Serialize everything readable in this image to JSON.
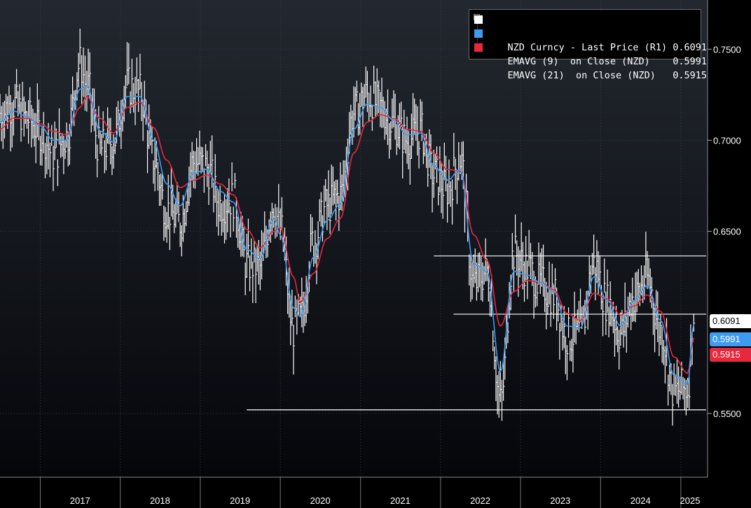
{
  "chart_data": {
    "type": "line",
    "x_range": [
      "2016-07",
      "2025-04"
    ],
    "ylim": [
      0.515,
      0.777
    ],
    "y_ticks": [
      "0.7500",
      "0.7000",
      "0.6500",
      "0.5500"
    ],
    "x_tick_labels": [
      "2017",
      "2018",
      "2019",
      "2020",
      "2021",
      "2022",
      "2023",
      "2024",
      "2025"
    ],
    "series": [
      {
        "name": "NZD Curncy - Last Price (R1)",
        "last": "0.6091",
        "color": "#ffffff",
        "x": [
          "2016-07",
          "2016-09",
          "2016-11",
          "2017-01",
          "2017-03",
          "2017-05",
          "2017-07",
          "2017-08",
          "2017-10",
          "2017-12",
          "2018-02",
          "2018-04",
          "2018-06",
          "2018-08",
          "2018-10",
          "2018-12",
          "2019-02",
          "2019-04",
          "2019-06",
          "2019-08",
          "2019-10",
          "2019-12",
          "2020-01",
          "2020-03",
          "2020-04",
          "2020-06",
          "2020-08",
          "2020-10",
          "2020-12",
          "2021-02",
          "2021-04",
          "2021-06",
          "2021-08",
          "2021-10",
          "2021-12",
          "2022-02",
          "2022-04",
          "2022-06",
          "2022-08",
          "2022-10",
          "2022-12",
          "2023-02",
          "2023-04",
          "2023-06",
          "2023-08",
          "2023-10",
          "2023-12",
          "2024-02",
          "2024-04",
          "2024-06",
          "2024-08",
          "2024-10",
          "2024-12",
          "2025-02",
          "2025-03"
        ],
        "values": [
          0.715,
          0.72,
          0.712,
          0.705,
          0.692,
          0.702,
          0.742,
          0.73,
          0.695,
          0.7,
          0.73,
          0.726,
          0.69,
          0.662,
          0.655,
          0.688,
          0.685,
          0.665,
          0.668,
          0.632,
          0.63,
          0.665,
          0.651,
          0.596,
          0.602,
          0.645,
          0.664,
          0.67,
          0.715,
          0.725,
          0.718,
          0.709,
          0.7,
          0.705,
          0.681,
          0.673,
          0.69,
          0.621,
          0.628,
          0.556,
          0.638,
          0.63,
          0.621,
          0.615,
          0.592,
          0.594,
          0.632,
          0.611,
          0.594,
          0.614,
          0.624,
          0.596,
          0.562,
          0.564,
          0.605
        ]
      },
      {
        "name": "EMAVG (9)  on Close (NZD)",
        "last": "0.5991",
        "color": "#3d9bf0",
        "x": [
          "2016-07",
          "2016-09",
          "2016-11",
          "2017-01",
          "2017-03",
          "2017-05",
          "2017-07",
          "2017-08",
          "2017-10",
          "2017-12",
          "2018-02",
          "2018-04",
          "2018-06",
          "2018-08",
          "2018-10",
          "2018-12",
          "2019-02",
          "2019-04",
          "2019-06",
          "2019-08",
          "2019-10",
          "2019-12",
          "2020-01",
          "2020-03",
          "2020-04",
          "2020-06",
          "2020-08",
          "2020-10",
          "2020-12",
          "2021-02",
          "2021-04",
          "2021-06",
          "2021-08",
          "2021-10",
          "2021-12",
          "2022-02",
          "2022-04",
          "2022-06",
          "2022-08",
          "2022-10",
          "2022-12",
          "2023-02",
          "2023-04",
          "2023-06",
          "2023-08",
          "2023-10",
          "2023-12",
          "2024-02",
          "2024-04",
          "2024-06",
          "2024-08",
          "2024-10",
          "2024-12",
          "2025-02",
          "2025-03"
        ],
        "values": [
          0.71,
          0.716,
          0.713,
          0.708,
          0.7,
          0.7,
          0.728,
          0.73,
          0.705,
          0.699,
          0.724,
          0.724,
          0.7,
          0.676,
          0.664,
          0.682,
          0.684,
          0.672,
          0.666,
          0.64,
          0.635,
          0.657,
          0.648,
          0.608,
          0.603,
          0.636,
          0.656,
          0.665,
          0.706,
          0.72,
          0.718,
          0.711,
          0.703,
          0.704,
          0.686,
          0.678,
          0.684,
          0.632,
          0.628,
          0.573,
          0.628,
          0.626,
          0.622,
          0.617,
          0.598,
          0.597,
          0.625,
          0.612,
          0.598,
          0.612,
          0.62,
          0.601,
          0.571,
          0.566,
          0.599
        ]
      },
      {
        "name": "EMAVG (21)  on Close (NZD)",
        "last": "0.5915",
        "color": "#e8283c",
        "x": [
          "2016-07",
          "2016-09",
          "2016-11",
          "2017-01",
          "2017-03",
          "2017-05",
          "2017-07",
          "2017-08",
          "2017-10",
          "2017-12",
          "2018-02",
          "2018-04",
          "2018-06",
          "2018-08",
          "2018-10",
          "2018-12",
          "2019-02",
          "2019-04",
          "2019-06",
          "2019-08",
          "2019-10",
          "2019-12",
          "2020-01",
          "2020-03",
          "2020-04",
          "2020-06",
          "2020-08",
          "2020-10",
          "2020-12",
          "2021-02",
          "2021-04",
          "2021-06",
          "2021-08",
          "2021-10",
          "2021-12",
          "2022-02",
          "2022-04",
          "2022-06",
          "2022-08",
          "2022-10",
          "2022-12",
          "2023-02",
          "2023-04",
          "2023-06",
          "2023-08",
          "2023-10",
          "2023-12",
          "2024-02",
          "2024-04",
          "2024-06",
          "2024-08",
          "2024-10",
          "2024-12",
          "2025-02",
          "2025-03"
        ],
        "values": [
          0.706,
          0.712,
          0.712,
          0.709,
          0.705,
          0.703,
          0.718,
          0.724,
          0.712,
          0.704,
          0.718,
          0.721,
          0.707,
          0.689,
          0.674,
          0.678,
          0.681,
          0.676,
          0.67,
          0.651,
          0.641,
          0.65,
          0.652,
          0.625,
          0.611,
          0.627,
          0.646,
          0.657,
          0.693,
          0.71,
          0.714,
          0.712,
          0.706,
          0.705,
          0.693,
          0.684,
          0.683,
          0.648,
          0.634,
          0.598,
          0.617,
          0.623,
          0.622,
          0.618,
          0.605,
          0.601,
          0.616,
          0.613,
          0.604,
          0.609,
          0.615,
          0.606,
          0.581,
          0.572,
          0.5915
        ]
      }
    ],
    "support_lines": [
      {
        "y": 0.6365,
        "x_from": "2021-12",
        "x_to": "2025-06"
      },
      {
        "y": 0.6045,
        "x_from": "2022-03",
        "x_to": "2025-06"
      },
      {
        "y": 0.552,
        "x_from": "2019-08",
        "x_to": "2025-06"
      }
    ],
    "grid": true
  },
  "legend": {
    "rows": [
      {
        "label": "NZD Curncy - Last Price (R1) 0.6091",
        "color": "#ffffff"
      },
      {
        "label": "EMAVG (9)  on Close (NZD)    0.5991",
        "color": "#3d9bf0"
      },
      {
        "label": "EMAVG (21)  on Close (NZD)   0.5915",
        "color": "#e8283c"
      }
    ],
    "collapse_icon": "minus-box-icon"
  },
  "last_values": [
    {
      "text": "0.6091",
      "bg": "#ffffff",
      "fg": "#000000"
    },
    {
      "text": "0.5991",
      "bg": "#3d9bf0",
      "fg": "#ffffff"
    },
    {
      "text": "0.5915",
      "bg": "#e8283c",
      "fg": "#ffffff"
    }
  ]
}
